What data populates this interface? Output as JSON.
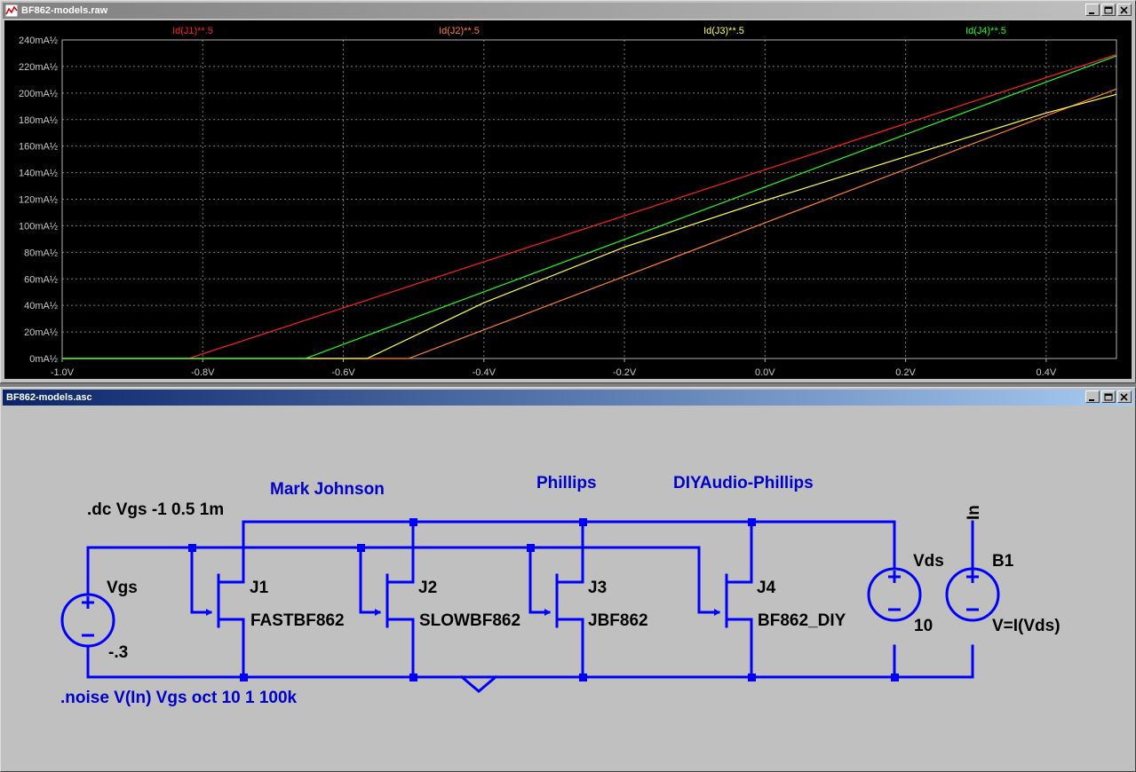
{
  "plot_window": {
    "title": "BF862-models.raw",
    "title_icon": "waveform-icon"
  },
  "schematic_window": {
    "title": "BF862-models.asc"
  },
  "chart_data": {
    "type": "line",
    "xlim": [
      -1.0,
      0.5
    ],
    "ylim": [
      0,
      240
    ],
    "xlabel": "",
    "ylabel": "",
    "x_ticks": [
      "-1.0V",
      "-0.8V",
      "-0.6V",
      "-0.4V",
      "-0.2V",
      "0.0V",
      "0.2V",
      "0.4V"
    ],
    "x_tick_values": [
      -1.0,
      -0.8,
      -0.6,
      -0.4,
      -0.2,
      0.0,
      0.2,
      0.4
    ],
    "y_ticks": [
      "0mA½",
      "20mA½",
      "40mA½",
      "60mA½",
      "80mA½",
      "100mA½",
      "120mA½",
      "140mA½",
      "160mA½",
      "180mA½",
      "200mA½",
      "220mA½",
      "240mA½"
    ],
    "y_tick_values": [
      0,
      20,
      40,
      60,
      80,
      100,
      120,
      140,
      160,
      180,
      200,
      220,
      240
    ],
    "grid": true,
    "background": "#000000",
    "series": [
      {
        "name": "Id(J1)**.5",
        "color": "#ff2020",
        "x": [
          -1.0,
          -0.82,
          0.5
        ],
        "y": [
          0,
          0,
          229
        ]
      },
      {
        "name": "Id(J2)**.5",
        "color": "#ff7f27",
        "x": [
          -1.0,
          -0.507,
          0.5
        ],
        "y": [
          0,
          0,
          203
        ]
      },
      {
        "name": "Id(J3)**.5",
        "color": "#ffff40",
        "x": [
          -1.0,
          -0.566,
          -0.4,
          -0.2,
          0.0,
          0.2,
          0.4,
          0.5
        ],
        "y": [
          0,
          0,
          42,
          84,
          119,
          152,
          185,
          199
        ]
      },
      {
        "name": "Id(J4)**.5",
        "color": "#20ff20",
        "x": [
          -1.0,
          -0.654,
          0.5
        ],
        "y": [
          0,
          0,
          228
        ]
      }
    ]
  },
  "schematic": {
    "directives": {
      "dc": ".dc Vgs -1 0.5 1m",
      "noise": ".noise V(In) Vgs oct 10 1 100k"
    },
    "comments": [
      "Mark Johnson",
      "Phillips",
      "DIYAudio-Phillips"
    ],
    "sources": [
      {
        "name": "Vgs",
        "value": "-.3"
      },
      {
        "name": "Vds",
        "value": "10"
      },
      {
        "name": "B1",
        "value": "V=I(Vds)"
      }
    ],
    "jfets": [
      {
        "name": "J1",
        "model": "FASTBF862"
      },
      {
        "name": "J2",
        "model": "SLOWBF862"
      },
      {
        "name": "J3",
        "model": "JBF862"
      },
      {
        "name": "J4",
        "model": "BF862_DIY"
      }
    ],
    "net_label": "In",
    "wire_color": "#0000ff",
    "text_color": "#0000cc"
  }
}
